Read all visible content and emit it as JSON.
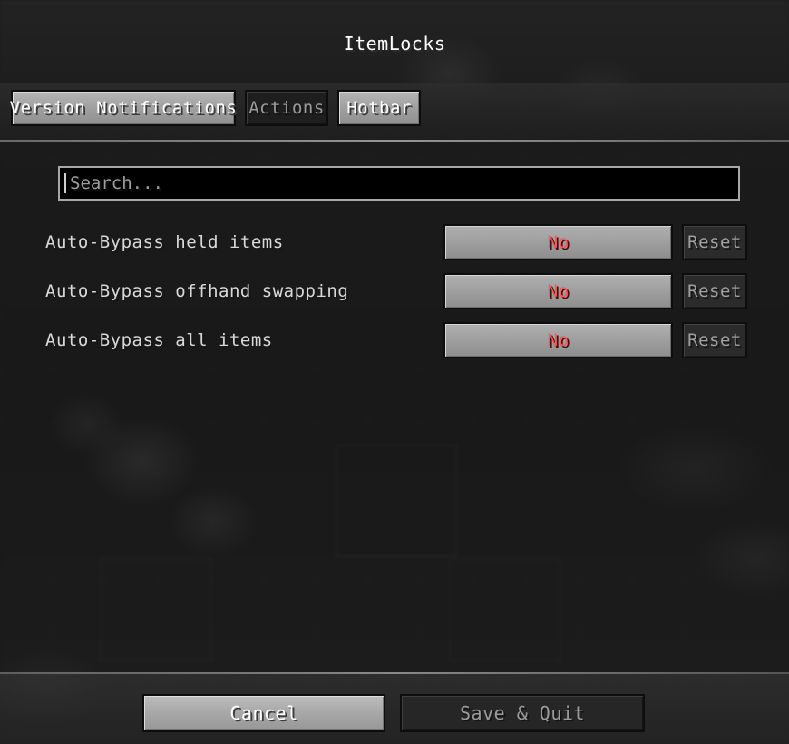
{
  "window": {
    "title": "ItemLocks"
  },
  "tabs": [
    {
      "label": "Version Notifications",
      "state": "selected"
    },
    {
      "label": "Actions",
      "state": "normal"
    },
    {
      "label": "Hotbar",
      "state": "selected"
    }
  ],
  "search": {
    "placeholder": "Search...",
    "value": ""
  },
  "options": [
    {
      "label": "Auto-Bypass held items",
      "value": "No",
      "reset_label": "Reset"
    },
    {
      "label": "Auto-Bypass offhand swapping",
      "value": "No",
      "reset_label": "Reset"
    },
    {
      "label": "Auto-Bypass all items",
      "value": "No",
      "reset_label": "Reset"
    }
  ],
  "footer": {
    "cancel_label": "Cancel",
    "save_quit_label": "Save & Quit"
  },
  "colors": {
    "value_red": "#FF5555",
    "panel_light": "#A0A0A0",
    "panel_dark": "#2B2B2B",
    "background": "#1D1D1D",
    "text": "#DDDDDD"
  }
}
